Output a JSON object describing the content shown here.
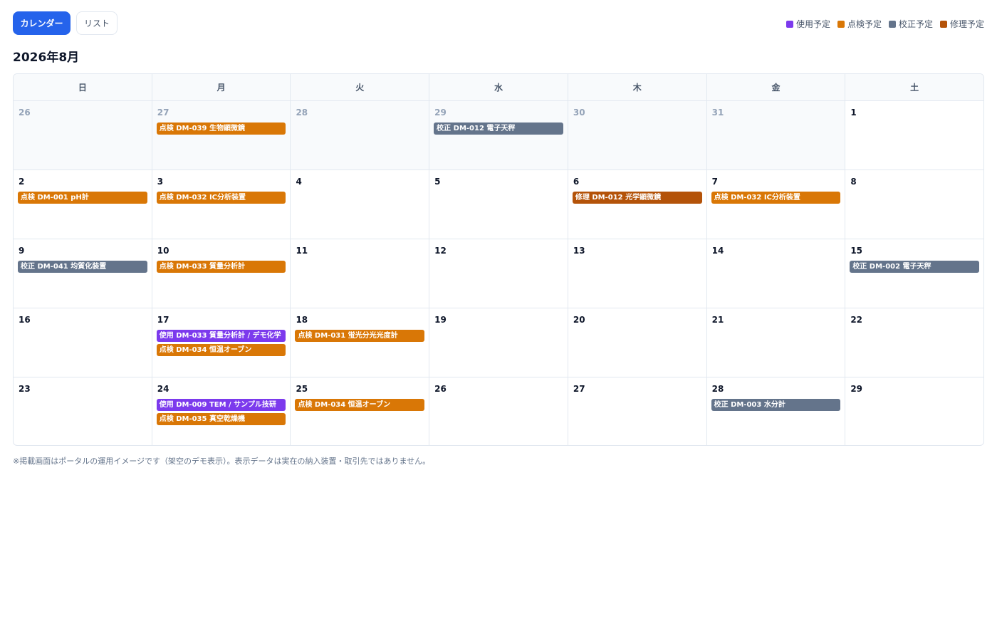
{
  "toolbar": {
    "calendar_label": "カレンダー",
    "list_label": "リスト"
  },
  "legend": [
    {
      "label": "使用予定",
      "color": "#7c3aed"
    },
    {
      "label": "点検予定",
      "color": "#d97706"
    },
    {
      "label": "校正予定",
      "color": "#64748b"
    },
    {
      "label": "修理予定",
      "color": "#b45309"
    }
  ],
  "month_title": "2026年8月",
  "weekdays": [
    "日",
    "月",
    "火",
    "水",
    "木",
    "金",
    "土"
  ],
  "weeks": [
    [
      {
        "num": "26",
        "other": true,
        "events": []
      },
      {
        "num": "27",
        "other": true,
        "events": [
          {
            "type": "inspect",
            "text": "点検 DM-039 生物顕微鏡"
          }
        ]
      },
      {
        "num": "28",
        "other": true,
        "events": []
      },
      {
        "num": "29",
        "other": true,
        "events": [
          {
            "type": "calib",
            "text": "校正 DM-012 電子天秤"
          }
        ]
      },
      {
        "num": "30",
        "other": true,
        "events": []
      },
      {
        "num": "31",
        "other": true,
        "events": []
      },
      {
        "num": "1",
        "other": false,
        "events": []
      }
    ],
    [
      {
        "num": "2",
        "other": false,
        "events": [
          {
            "type": "inspect",
            "text": "点検 DM-001 pH計"
          }
        ]
      },
      {
        "num": "3",
        "other": false,
        "events": [
          {
            "type": "inspect",
            "text": "点検 DM-032 IC分析装置"
          }
        ]
      },
      {
        "num": "4",
        "other": false,
        "events": []
      },
      {
        "num": "5",
        "other": false,
        "events": []
      },
      {
        "num": "6",
        "other": false,
        "events": [
          {
            "type": "repair",
            "text": "修理 DM-012 光学顕微鏡"
          }
        ]
      },
      {
        "num": "7",
        "other": false,
        "events": [
          {
            "type": "inspect",
            "text": "点検 DM-032 IC分析装置"
          }
        ]
      },
      {
        "num": "8",
        "other": false,
        "events": []
      }
    ],
    [
      {
        "num": "9",
        "other": false,
        "events": [
          {
            "type": "calib",
            "text": "校正 DM-041 均質化装置"
          }
        ]
      },
      {
        "num": "10",
        "other": false,
        "events": [
          {
            "type": "inspect",
            "text": "点検 DM-033 質量分析計"
          }
        ]
      },
      {
        "num": "11",
        "other": false,
        "events": []
      },
      {
        "num": "12",
        "other": false,
        "events": []
      },
      {
        "num": "13",
        "other": false,
        "events": []
      },
      {
        "num": "14",
        "other": false,
        "events": []
      },
      {
        "num": "15",
        "other": false,
        "events": [
          {
            "type": "calib",
            "text": "校正 DM-002 電子天秤"
          }
        ]
      }
    ],
    [
      {
        "num": "16",
        "other": false,
        "events": []
      },
      {
        "num": "17",
        "other": false,
        "events": [
          {
            "type": "use",
            "text": "使用 DM-033 質量分析計 / デモ化学"
          },
          {
            "type": "inspect",
            "text": "点検 DM-034 恒温オーブン"
          }
        ]
      },
      {
        "num": "18",
        "other": false,
        "events": [
          {
            "type": "inspect",
            "text": "点検 DM-031 蛍光分光光度計"
          }
        ]
      },
      {
        "num": "19",
        "other": false,
        "events": []
      },
      {
        "num": "20",
        "other": false,
        "events": []
      },
      {
        "num": "21",
        "other": false,
        "events": []
      },
      {
        "num": "22",
        "other": false,
        "events": []
      }
    ],
    [
      {
        "num": "23",
        "other": false,
        "events": []
      },
      {
        "num": "24",
        "other": false,
        "events": [
          {
            "type": "use",
            "text": "使用 DM-009 TEM / サンプル技研"
          },
          {
            "type": "inspect",
            "text": "点検 DM-035 真空乾燥機"
          }
        ]
      },
      {
        "num": "25",
        "other": false,
        "events": [
          {
            "type": "inspect",
            "text": "点検 DM-034 恒温オーブン"
          }
        ]
      },
      {
        "num": "26",
        "other": false,
        "events": []
      },
      {
        "num": "27",
        "other": false,
        "events": []
      },
      {
        "num": "28",
        "other": false,
        "events": [
          {
            "type": "calib",
            "text": "校正 DM-003 水分計"
          }
        ]
      },
      {
        "num": "29",
        "other": false,
        "events": []
      }
    ]
  ],
  "footnote": "※掲載画面はポータルの運用イメージです（架空のデモ表示）。表示データは実在の納入装置・取引先ではありません。"
}
